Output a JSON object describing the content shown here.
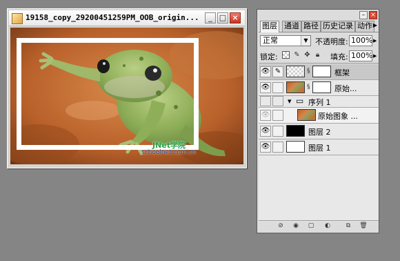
{
  "document": {
    "title": "19158_copy_29200451259PM_OOB_origin...",
    "watermark_logo": "JNet学院",
    "watermark_url": "schoolnet.com.cn"
  },
  "layers_panel": {
    "tabs": [
      "图层",
      "通道",
      "路径",
      "历史记录",
      "动作"
    ],
    "blend_mode": "正常",
    "opacity_label": "不透明度:",
    "opacity_value": "100%",
    "lock_label": "锁定:",
    "fill_label": "填充:",
    "fill_value": "100%",
    "layers": [
      {
        "name": "框架",
        "visible": true,
        "selected": true,
        "thumb": "transparent",
        "mask": true
      },
      {
        "name": "原始...",
        "visible": true,
        "selected": false,
        "thumb": "frog",
        "mask": true
      },
      {
        "name": "序列 1",
        "visible": false,
        "selected": false,
        "type": "group"
      },
      {
        "name": "原始图象 ...",
        "visible": false,
        "selected": false,
        "thumb": "frog",
        "indented": true
      },
      {
        "name": "图层 2",
        "visible": true,
        "selected": false,
        "thumb": "black"
      },
      {
        "name": "图层 1",
        "visible": true,
        "selected": false,
        "thumb": "white"
      }
    ],
    "bottom_icons": [
      "link-icon",
      "layer-style-icon",
      "mask-icon",
      "new-set-icon",
      "adjustment-layer-icon",
      "new-layer-icon",
      "trash-icon"
    ]
  },
  "colors": {
    "workspace_bg": "#858585",
    "panel_bg": "#dcdcdc",
    "close_red": "#d84b33"
  }
}
